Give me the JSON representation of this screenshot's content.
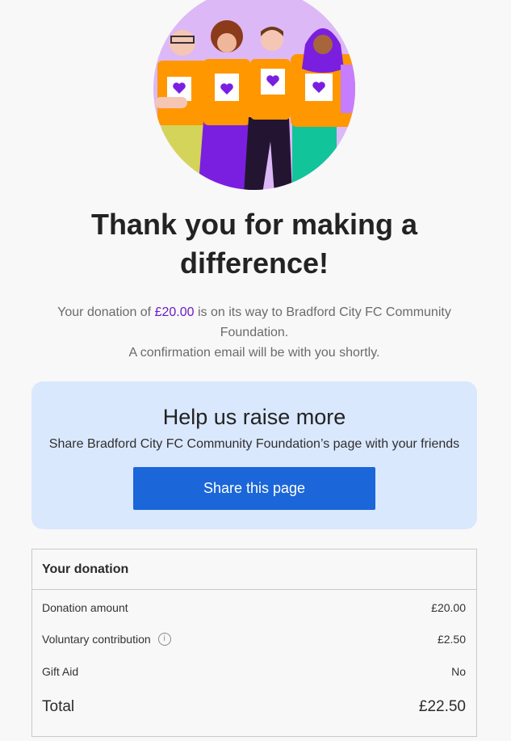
{
  "heading": "Thank you for making a difference!",
  "message": {
    "prefix": "Your donation of ",
    "amount": "£20.00",
    "suffix": " is on its way to Bradford City FC Community Foundation.",
    "confirmation": "A confirmation email will be with you shortly."
  },
  "share": {
    "title": "Help us raise more",
    "subtitle": "Share Bradford City FC Community Foundation’s page with your friends",
    "button_label": "Share this page"
  },
  "donation_summary": {
    "title": "Your donation",
    "rows": [
      {
        "label": "Donation amount",
        "value": "£20.00"
      },
      {
        "label": "Voluntary contribution",
        "value": "£2.50"
      },
      {
        "label": "Gift Aid",
        "value": "No"
      }
    ],
    "total_label": "Total",
    "total_value": "£22.50"
  },
  "icons": {
    "info": "info-circle-icon",
    "hero": "volunteers-illustration"
  },
  "colors": {
    "accent_purple": "#6d1ac9",
    "share_button": "#1b66d8",
    "share_card_bg": "#dae8fd",
    "hero_bg": "#ddb8f6"
  }
}
